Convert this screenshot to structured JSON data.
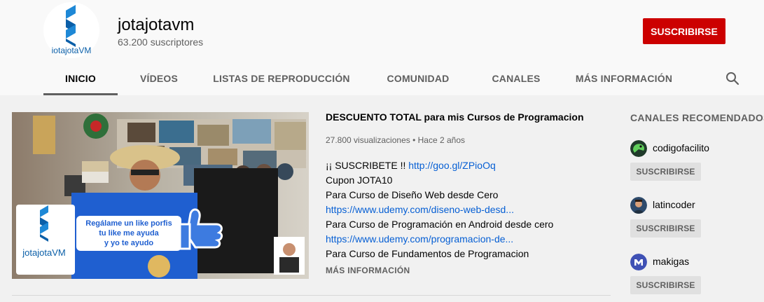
{
  "channel": {
    "name": "jotajotavm",
    "subscribers": "63.200 suscriptores",
    "logo_text": "iotajotaVM",
    "subscribe_label": "SUSCRIBIRSE"
  },
  "tabs": [
    {
      "label": "INICIO",
      "active": true
    },
    {
      "label": "VÍDEOS",
      "active": false
    },
    {
      "label": "LISTAS DE REPRODUCCIÓN",
      "active": false
    },
    {
      "label": "COMUNIDAD",
      "active": false
    },
    {
      "label": "CANALES",
      "active": false
    },
    {
      "label": "MÁS INFORMACIÓN",
      "active": false
    }
  ],
  "icons": {
    "search": "search-icon"
  },
  "featured": {
    "title": "DESCUENTO TOTAL para mis Cursos de Programacion",
    "meta": "27.800 visualizaciones • Hace 2 años",
    "thumb_bubble": [
      "Regálame un like porfis",
      "tu like me ayuda",
      "y yo te ayudo"
    ],
    "thumb_logo": "jotajotaVM",
    "description": {
      "line1_prefix": "¡¡ SUSCRIBETE !! ",
      "line1_link": "http://goo.gl/ZPioOq",
      "line2": "Cupon JOTA10",
      "line3": "Para Curso de Diseño Web desde Cero",
      "line4_link": "https://www.udemy.com/diseno-web-desd...",
      "line5": "Para Curso de Programación en Android desde cero",
      "line6_link": "https://www.udemy.com/programacion-de...",
      "line7": "Para Curso de Fundamentos de Programacion"
    },
    "more_label": "MÁS INFORMACIÓN"
  },
  "sidebar": {
    "title": "CANALES RECOMENDADOS",
    "channels": [
      {
        "name": "codigofacilito",
        "button": "SUSCRIBIRSE"
      },
      {
        "name": "latincoder",
        "button": "SUSCRIBIRSE"
      },
      {
        "name": "makigas",
        "button": "SUSCRIBIRSE"
      }
    ]
  },
  "colors": {
    "subscribe": "#cc0000",
    "link": "#065fd4",
    "brand": "#2d7fc1"
  }
}
